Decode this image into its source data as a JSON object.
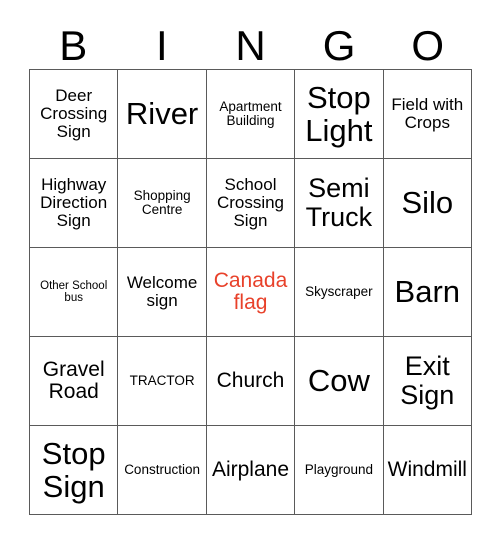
{
  "card": {
    "header_letters": [
      "B",
      "I",
      "N",
      "G",
      "O"
    ],
    "accent_color": "#E8412A",
    "grid_line_color": "#5a5a5a",
    "rows": [
      [
        {
          "label": "Deer Crossing Sign",
          "size": "sm",
          "color": "#000000"
        },
        {
          "label": "River",
          "size": "xl",
          "color": "#000000"
        },
        {
          "label": "Apartment Building",
          "size": "xs",
          "color": "#000000"
        },
        {
          "label": "Stop Light",
          "size": "xl",
          "color": "#000000"
        },
        {
          "label": "Field with Crops",
          "size": "sm",
          "color": "#000000"
        }
      ],
      [
        {
          "label": "Highway Direction Sign",
          "size": "sm",
          "color": "#000000"
        },
        {
          "label": "Shopping Centre",
          "size": "xs",
          "color": "#000000"
        },
        {
          "label": "School Crossing Sign",
          "size": "sm",
          "color": "#000000"
        },
        {
          "label": "Semi Truck",
          "size": "lg",
          "color": "#000000"
        },
        {
          "label": "Silo",
          "size": "xl",
          "color": "#000000"
        }
      ],
      [
        {
          "label": "Other School bus",
          "size": "xxs",
          "color": "#000000"
        },
        {
          "label": "Welcome sign",
          "size": "sm",
          "color": "#000000"
        },
        {
          "label": "Canada flag",
          "size": "md",
          "color": "#E8412A"
        },
        {
          "label": "Skyscraper",
          "size": "xs",
          "color": "#000000"
        },
        {
          "label": "Barn",
          "size": "xl",
          "color": "#000000"
        }
      ],
      [
        {
          "label": "Gravel Road",
          "size": "md",
          "color": "#000000"
        },
        {
          "label": "TRACTOR",
          "size": "xs",
          "color": "#000000"
        },
        {
          "label": "Church",
          "size": "md",
          "color": "#000000"
        },
        {
          "label": "Cow",
          "size": "xl",
          "color": "#000000"
        },
        {
          "label": "Exit Sign",
          "size": "lg",
          "color": "#000000"
        }
      ],
      [
        {
          "label": "Stop Sign",
          "size": "xl",
          "color": "#000000"
        },
        {
          "label": "Construction",
          "size": "xs",
          "color": "#000000"
        },
        {
          "label": "Airplane",
          "size": "md",
          "color": "#000000"
        },
        {
          "label": "Playground",
          "size": "xs",
          "color": "#000000"
        },
        {
          "label": "Windmill",
          "size": "md",
          "color": "#000000"
        }
      ]
    ]
  }
}
